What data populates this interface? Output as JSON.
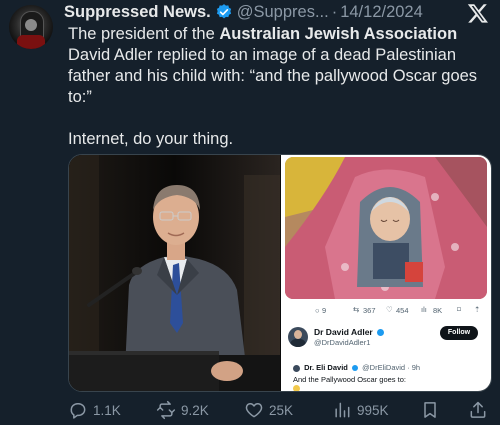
{
  "tweet": {
    "author_name": "Suppressed News.",
    "handle": "@Suppres...",
    "separator": "·",
    "date": "14/12/2024",
    "text_line1_pre": "The president of the ",
    "text_line1_bold": "Australian Jewish Association",
    "text_line1_post": " David Adler replied to an image of a dead Palestinian father and his child with: “and the pallywood Oscar goes to:”",
    "text_line2": "Internet, do your thing."
  },
  "embedded_screenshot": {
    "stats": {
      "replies": "9",
      "reposts": "367",
      "likes": "454",
      "views": "8K"
    },
    "profile_name": "Dr David Adler",
    "profile_handle": "@DrDavidAdler1",
    "follow_label": "Follow",
    "reply_author": "Dr. Eli David",
    "reply_handle": "@DrEliDavid · 9h",
    "reply_text": "And the Pallywood Oscar goes to:"
  },
  "actions": {
    "replies": "1.1K",
    "reposts": "9.2K",
    "likes": "25K",
    "views": "995K"
  },
  "colors": {
    "background": "#15202b",
    "text": "#e7e9ea",
    "muted": "#8b98a5",
    "verified": "#1d9bf0"
  },
  "icons": [
    "x-logo-icon",
    "verified-badge-icon",
    "reply-icon",
    "repost-icon",
    "like-icon",
    "views-icon",
    "bookmark-icon",
    "share-icon"
  ]
}
